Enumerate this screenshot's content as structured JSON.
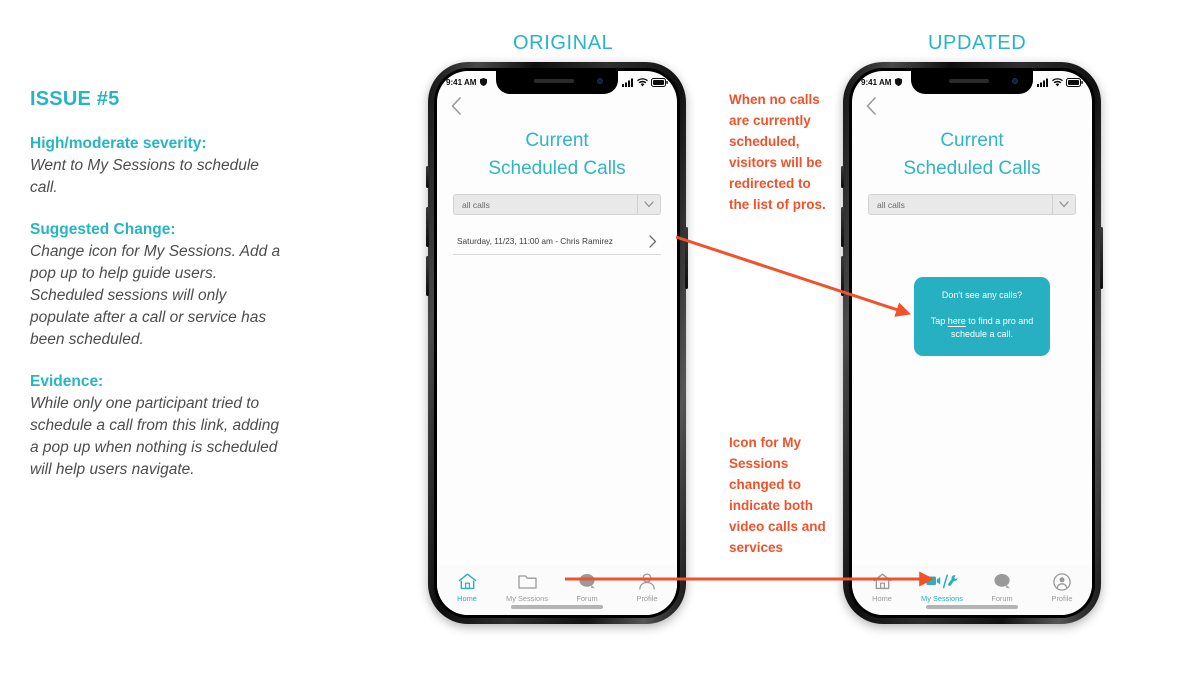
{
  "issue": {
    "title": "ISSUE #5",
    "blocks": [
      {
        "heading": "High/moderate severity:",
        "body": "Went to My Sessions to schedule call."
      },
      {
        "heading": "Suggested Change:",
        "body": "Change icon for My Sessions. Add a pop up to help guide users. Scheduled sessions will only populate after a call or service has been scheduled."
      },
      {
        "heading": "Evidence:",
        "body": "While only one participant tried to schedule a call from this link, adding a pop up when nothing is scheduled will help users navigate."
      }
    ]
  },
  "sections": {
    "original": "ORIGINAL",
    "updated": "UPDATED"
  },
  "phone_original": {
    "status_bar": {
      "time": "9:41 AM"
    },
    "screen_title_line1": "Current",
    "screen_title_line2": "Scheduled Calls",
    "dropdown": {
      "value": "all calls"
    },
    "call_rows": [
      {
        "text": "Saturday, 11/23, 11:00 am - Chris Ramirez"
      }
    ],
    "tabs": [
      {
        "label": "Home",
        "icon": "home-icon",
        "active": true
      },
      {
        "label": "My Sessions",
        "icon": "folder-icon",
        "active": false
      },
      {
        "label": "Forum",
        "icon": "speech-bubble-icon",
        "active": false
      },
      {
        "label": "Profile",
        "icon": "person-icon",
        "active": false
      }
    ]
  },
  "phone_updated": {
    "status_bar": {
      "time": "9:41 AM"
    },
    "screen_title_line1": "Current",
    "screen_title_line2": "Scheduled Calls",
    "dropdown": {
      "value": "all calls"
    },
    "popup": {
      "heading": "Don't see any calls?",
      "body_before_link": "Tap ",
      "body_link": "here",
      "body_after_link": " to find a pro and schedule a call."
    },
    "tabs": [
      {
        "label": "Home",
        "icon": "home-icon",
        "active": false
      },
      {
        "label": "My Sessions",
        "icon": "video-wrench-icon",
        "active": true
      },
      {
        "label": "Forum",
        "icon": "speech-bubble-icon",
        "active": false
      },
      {
        "label": "Profile",
        "icon": "person-circle-icon",
        "active": false
      }
    ]
  },
  "annotations": {
    "popup_note": "When no calls are currently scheduled, visitors will be redirected to the list of pros.",
    "icon_note": "Icon for My Sessions changed to indicate both video calls and services"
  },
  "colors": {
    "teal": "#27b0c2",
    "orange": "#f0522a",
    "body_text": "#4d4d4d"
  }
}
